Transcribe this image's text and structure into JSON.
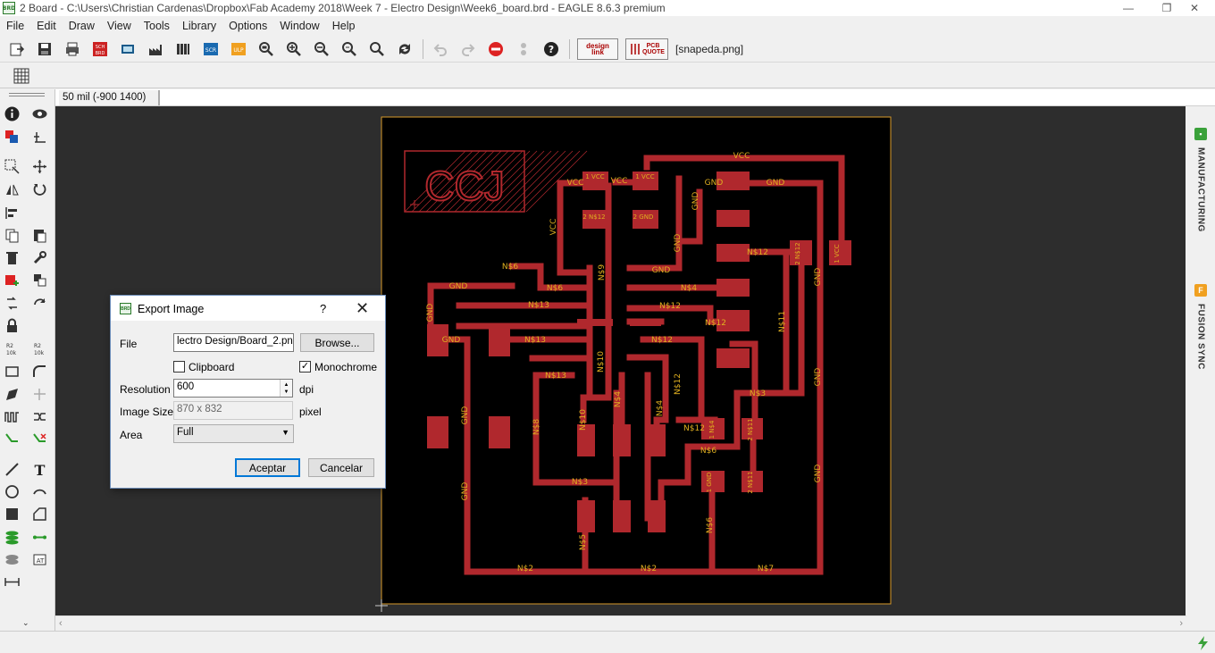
{
  "window": {
    "title": "2 Board - C:\\Users\\Christian Cardenas\\Dropbox\\Fab Academy 2018\\Week 7 - Electro Design\\Week6_board.brd - EAGLE 8.6.3 premium",
    "icon_label": "BRD"
  },
  "menu": [
    "File",
    "Edit",
    "Draw",
    "View",
    "Tools",
    "Library",
    "Options",
    "Window",
    "Help"
  ],
  "toolbar": {
    "designlink_label": "design link",
    "pcbquote_label": "PCB QUOTE",
    "sch_brd_label": "SCH BRD",
    "scr_label": "SCR",
    "ulp_label": "ULP",
    "script_file": "[snapeda.png]"
  },
  "coords": "50 mil (-900 1400)",
  "right_panel": {
    "tabs": [
      {
        "label": "MANUFACTURING",
        "color": "#3aa13a"
      },
      {
        "label": "FUSION SYNC",
        "color": "#f0a020"
      }
    ]
  },
  "board": {
    "logo_text": "CCJ",
    "trace_color": "#b0282d",
    "label_color": "#e0b020",
    "outline_color": "#d89a2a",
    "net_labels": [
      "VCC",
      "VCC",
      "VCC",
      "VCC",
      "GND",
      "GND",
      "GND",
      "GND",
      "GND",
      "GND",
      "GND",
      "GND",
      "GND",
      "GND",
      "GND",
      "GND",
      "GND",
      "N$2",
      "N$2",
      "N$7",
      "N$5",
      "N$6",
      "N$6",
      "N$6",
      "N$13",
      "N$13",
      "N$13",
      "N$8",
      "N$3",
      "N$9",
      "N$10",
      "N$10",
      "N$4",
      "N$4",
      "N$4",
      "N$12",
      "N$12",
      "N$12",
      "N$12",
      "N$12",
      "N$12",
      "N$11",
      "N$3",
      "N$6"
    ],
    "pad_labels": [
      "1 VCC",
      "1 VCC",
      "2 N$12",
      "2 GND",
      "2 N$12",
      "1 VCC",
      "1 N$4",
      "2 N$11",
      "1 GND",
      "2 N$11"
    ]
  },
  "dialog": {
    "title": "Export Image",
    "help": "?",
    "file_label": "File",
    "file_value": "lectro Design/Board_2.png",
    "browse_label": "Browse...",
    "clipboard_label": "Clipboard",
    "clipboard_checked": false,
    "monochrome_label": "Monochrome",
    "monochrome_checked": true,
    "resolution_label": "Resolution",
    "resolution_value": "600",
    "resolution_unit": "dpi",
    "image_size_label": "Image Size",
    "image_size_value": "870 x 832",
    "image_size_unit": "pixel",
    "area_label": "Area",
    "area_value": "Full",
    "accept_label": "Aceptar",
    "cancel_label": "Cancelar"
  }
}
